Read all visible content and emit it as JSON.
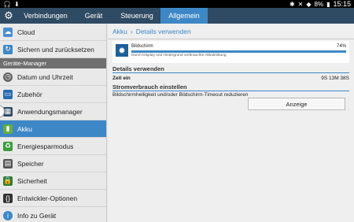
{
  "status": {
    "battery": "8%",
    "time": "15:15"
  },
  "tabs": [
    {
      "label": "Verbindungen",
      "active": false
    },
    {
      "label": "Gerät",
      "active": false
    },
    {
      "label": "Steuerung",
      "active": false
    },
    {
      "label": "Allgemein",
      "active": true
    }
  ],
  "sidebar": {
    "items": [
      {
        "label": "Cloud",
        "icon": "cloud-icon",
        "color": "#4a8fd0"
      },
      {
        "label": "Sichern und zurücksetzen",
        "icon": "backup-icon",
        "color": "#3d87c6"
      }
    ],
    "section_header": "Geräte-Manager",
    "manager_items": [
      {
        "label": "Datum und Uhrzeit",
        "icon": "clock-icon",
        "color": "#666"
      },
      {
        "label": "Zubehör",
        "icon": "laptop-icon",
        "color": "#2a6ab1"
      },
      {
        "label": "Anwendungsmanager",
        "icon": "apps-grid-icon",
        "color": "#2f4a63"
      },
      {
        "label": "Akku",
        "icon": "battery-icon",
        "color": "#5fb03e",
        "active": true
      },
      {
        "label": "Energiesparmodus",
        "icon": "power-save-icon",
        "color": "#3a9c3a"
      },
      {
        "label": "Speicher",
        "icon": "storage-icon",
        "color": "#555"
      },
      {
        "label": "Sicherheit",
        "icon": "lock-icon",
        "color": "#2f7d35"
      },
      {
        "label": "Entwickler-Optionen",
        "icon": "braces-icon",
        "color": "#333"
      },
      {
        "label": "Info zu Gerät",
        "icon": "info-icon",
        "color": "#3d87c6"
      }
    ]
  },
  "breadcrumb": {
    "parent": "Akku",
    "current": "Details verwenden"
  },
  "battery_usage": {
    "name": "Bildschirm",
    "percent": "74%",
    "description": "Durch Display und Hintergrund verbrauchte Akkuleistung"
  },
  "details": {
    "header": "Details verwenden",
    "key": "Zeit ein",
    "value": "9S 13M 38S"
  },
  "power": {
    "header": "Stromverbrauch einstellen",
    "description": "Bildschirmhelligkeit und/oder Bildschirm-Timeout reduzieren",
    "button": "Anzeige"
  }
}
